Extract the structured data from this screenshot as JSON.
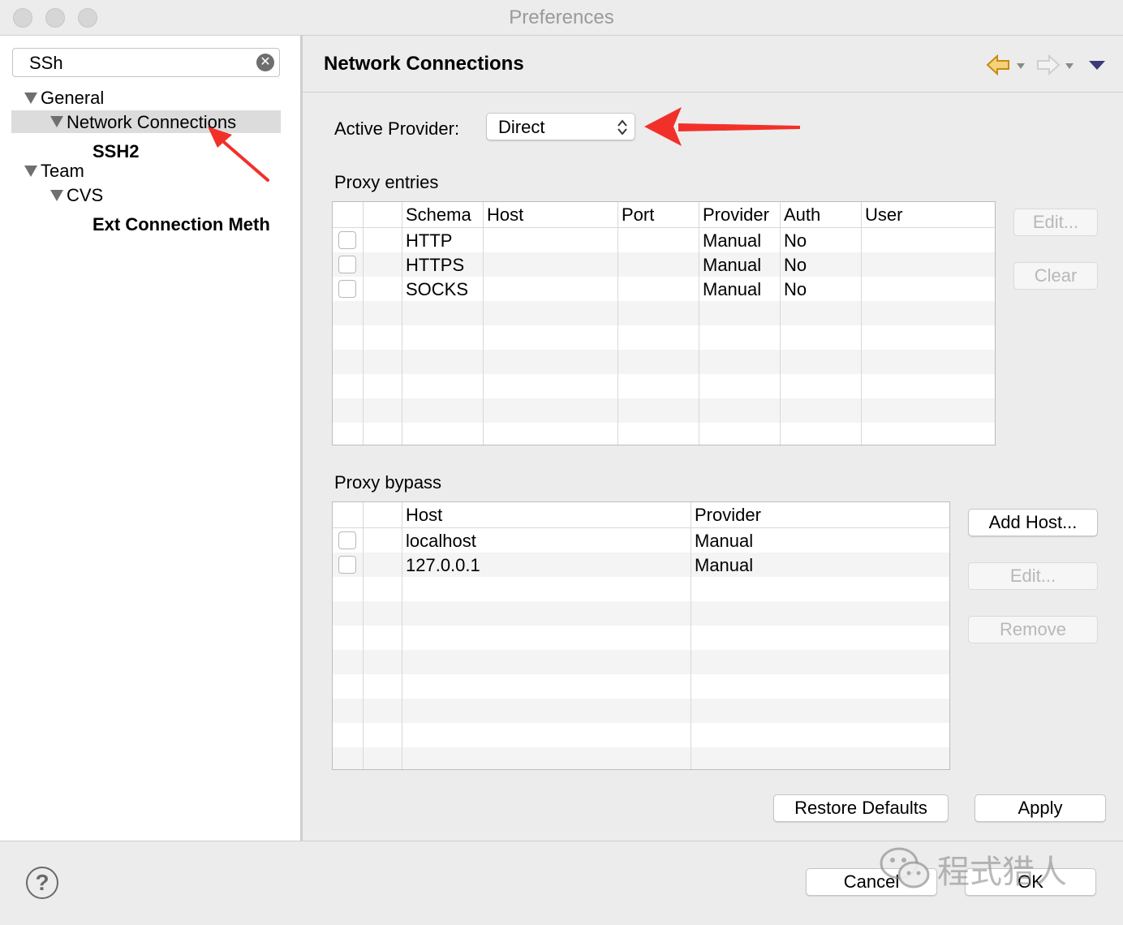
{
  "window": {
    "title": "Preferences"
  },
  "sidebar": {
    "search_value": "SSh",
    "tree": [
      {
        "label": "General"
      },
      {
        "label": "Network Connections"
      },
      {
        "label": "SSH2"
      },
      {
        "label": "Team"
      },
      {
        "label": "CVS"
      },
      {
        "label": "Ext Connection Meth"
      }
    ]
  },
  "page": {
    "title": "Network Connections",
    "nav_icons": [
      "back-arrow-icon",
      "forward-arrow-icon",
      "view-menu-icon"
    ],
    "active_provider_label": "Active Provider:",
    "active_provider_value": "Direct",
    "proxy_entries": {
      "label": "Proxy entries",
      "columns": [
        "Schema",
        "Host",
        "Port",
        "Provider",
        "Auth",
        "User"
      ],
      "rows": [
        {
          "schema": "HTTP",
          "host": "",
          "port": "",
          "provider": "Manual",
          "auth": "No",
          "user": ""
        },
        {
          "schema": "HTTPS",
          "host": "",
          "port": "",
          "provider": "Manual",
          "auth": "No",
          "user": ""
        },
        {
          "schema": "SOCKS",
          "host": "",
          "port": "",
          "provider": "Manual",
          "auth": "No",
          "user": ""
        }
      ],
      "buttons": {
        "edit": "Edit...",
        "clear": "Clear"
      }
    },
    "proxy_bypass": {
      "label": "Proxy bypass",
      "columns": [
        "Host",
        "Provider"
      ],
      "rows": [
        {
          "host": "localhost",
          "provider": "Manual"
        },
        {
          "host": "127.0.0.1",
          "provider": "Manual"
        }
      ],
      "buttons": {
        "add_host": "Add Host...",
        "edit": "Edit...",
        "remove": "Remove"
      }
    },
    "restore_defaults": "Restore Defaults",
    "apply": "Apply"
  },
  "footer": {
    "cancel": "Cancel",
    "ok": "OK",
    "help_icon": "?"
  },
  "watermark": "程式猎人",
  "colors": {
    "annotation_arrow": "#f2302a",
    "nav_arrow": "#e8a825",
    "view_menu": "#3b3b7a"
  }
}
